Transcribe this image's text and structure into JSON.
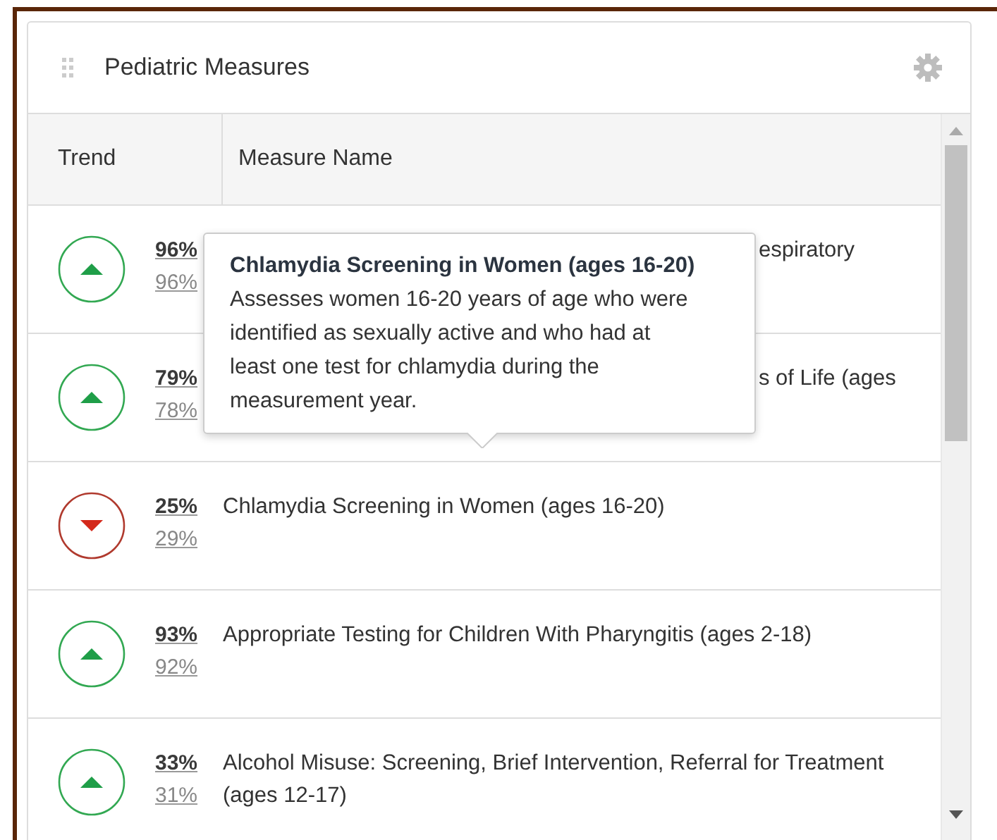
{
  "panel": {
    "title": "Pediatric Measures"
  },
  "table": {
    "columns": [
      "Trend",
      "Measure Name"
    ],
    "rows": [
      {
        "improved": true,
        "current": "96%",
        "previous": "96%",
        "name": "espiratory",
        "kind": "covered"
      },
      {
        "improved": true,
        "current": "79%",
        "previous": "78%",
        "name": "s of Life (ages",
        "kind": "covered"
      },
      {
        "improved": false,
        "current": "25%",
        "previous": "29%",
        "name": "Chlamydia Screening in Women (ages 16-20)",
        "kind": "full"
      },
      {
        "improved": true,
        "current": "93%",
        "previous": "92%",
        "name": "Appropriate Testing for Children With Pharyngitis (ages 2-18)",
        "kind": "full"
      },
      {
        "improved": true,
        "current": "33%",
        "previous": "31%",
        "name": "Alcohol Misuse: Screening, Brief Intervention, Referral for Treatment (ages 12-17)",
        "kind": "full"
      }
    ]
  },
  "tooltip": {
    "title": "Chlamydia Screening in Women (ages 16-20)",
    "body": "Assesses women 16-20 years of age who were identified as sexually active and who had at least one test for chlamydia during the measurement year."
  }
}
